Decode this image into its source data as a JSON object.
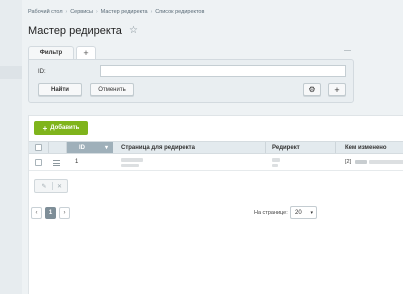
{
  "breadcrumb": [
    "Рабочий стол",
    "Сервисы",
    "Мастер редиректа",
    "Список редиректов"
  ],
  "page": {
    "title": "Мастер редиректа"
  },
  "filter": {
    "tab_label": "Фильтр",
    "add_tab": "+",
    "minimize": "—",
    "id_label": "ID:",
    "id_value": "",
    "find_label": "Найти",
    "cancel_label": "Отменить",
    "gear_icon": "⚙",
    "add_icon": "+"
  },
  "toolbar": {
    "add_label": "Добавить",
    "add_icon": "+"
  },
  "grid": {
    "columns": [
      "ID",
      "Страница для редиректа",
      "Редирект",
      "Кем изменено"
    ],
    "sort_icon": "▾",
    "rows": [
      {
        "id": "1",
        "changed_by_prefix": "[2]"
      }
    ],
    "row_actions": {
      "edit": "✎",
      "delete": "✕"
    }
  },
  "pager": {
    "prev": "‹",
    "current": "1",
    "next": "›"
  },
  "per_page": {
    "label": "На странице:",
    "value": "20"
  },
  "colors": {
    "accent_green": "#7fb41c",
    "header_active": "#9fb0ba"
  }
}
